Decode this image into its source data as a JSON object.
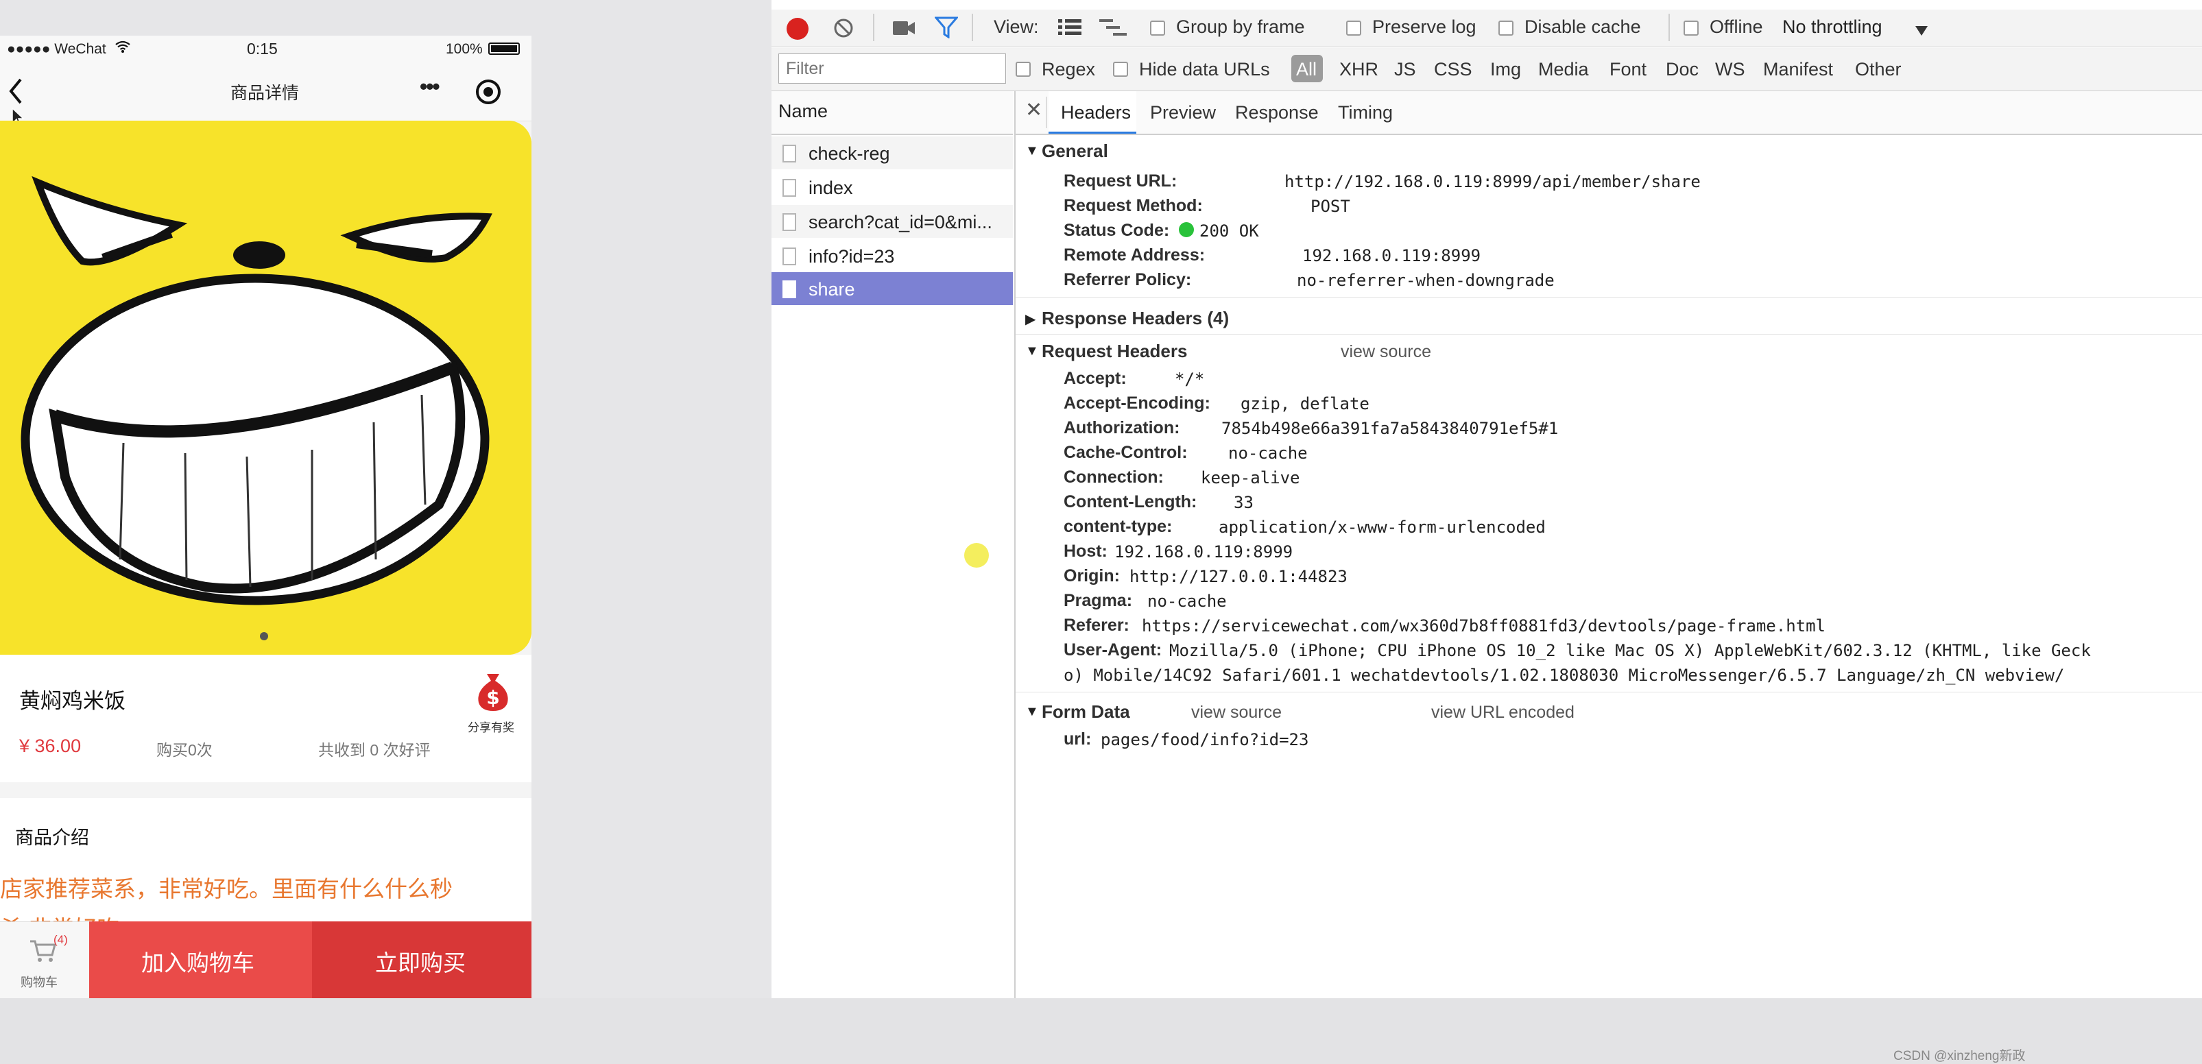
{
  "phone": {
    "status": {
      "carrier": "●●●●● WeChat",
      "wifi_icon": "wifi-icon",
      "time": "0:15",
      "battery": "100%",
      "battery_icon": "battery-icon"
    },
    "nav": {
      "title": "商品详情",
      "more": "•••"
    },
    "product": {
      "name": "黄焖鸡米饭",
      "price": "¥ 36.00",
      "bought": "购买0次",
      "reviews": "共收到 0 次好评",
      "share_label": "分享有奖"
    },
    "intro": {
      "heading": "商品介绍",
      "text": "店家推荐菜系，非常好吃。里面有什么什么秒",
      "text2": "杀 非常好吃"
    },
    "bottom": {
      "cart_badge": "(4)",
      "cart_label": "购物车",
      "add_cart": "加入购物车",
      "buy_now": "立即购买"
    },
    "colors": {
      "yellow": "#F7E32A",
      "price": "#E0393E",
      "add_cart_bg": "#EA4B49",
      "buy_bg": "#D83737"
    }
  },
  "devtools": {
    "toolbar": {
      "view_label": "View:",
      "group_by_frame": "Group by frame",
      "preserve_log": "Preserve log",
      "disable_cache": "Disable cache",
      "offline": "Offline",
      "throttling": "No throttling"
    },
    "filter": {
      "placeholder": "Filter",
      "regex": "Regex",
      "hide_data_urls": "Hide data URLs",
      "types": [
        "All",
        "XHR",
        "JS",
        "CSS",
        "Img",
        "Media",
        "Font",
        "Doc",
        "WS",
        "Manifest",
        "Other"
      ]
    },
    "name_header": "Name",
    "requests": [
      "check-reg",
      "index",
      "search?cat_id=0&mi...",
      "info?id=23",
      "share"
    ],
    "tabs": [
      "Headers",
      "Preview",
      "Response",
      "Timing"
    ],
    "general": {
      "title": "General",
      "request_url_label": "Request URL:",
      "request_url": "http://192.168.0.119:8999/api/member/share",
      "request_method_label": "Request Method:",
      "request_method": "POST",
      "status_code_label": "Status Code:",
      "status_code": "200 OK",
      "remote_address_label": "Remote Address:",
      "remote_address": "192.168.0.119:8999",
      "referrer_policy_label": "Referrer Policy:",
      "referrer_policy": "no-referrer-when-downgrade"
    },
    "response_headers_title": "Response Headers (4)",
    "request_headers": {
      "title": "Request Headers",
      "view_source": "view source",
      "rows": [
        {
          "k": "Accept:",
          "v": "*/*"
        },
        {
          "k": "Accept-Encoding:",
          "v": "gzip, deflate"
        },
        {
          "k": "Authorization:",
          "v": "7854b498e66a391fa7a5843840791ef5#1"
        },
        {
          "k": "Cache-Control:",
          "v": "no-cache"
        },
        {
          "k": "Connection:",
          "v": "keep-alive"
        },
        {
          "k": "Content-Length:",
          "v": "33"
        },
        {
          "k": "content-type:",
          "v": "application/x-www-form-urlencoded"
        },
        {
          "k": "Host:",
          "v": "192.168.0.119:8999"
        },
        {
          "k": "Origin:",
          "v": "http://127.0.0.1:44823"
        },
        {
          "k": "Pragma:",
          "v": "no-cache"
        },
        {
          "k": "Referer:",
          "v": "https://servicewechat.com/wx360d7b8ff0881fd3/devtools/page-frame.html"
        },
        {
          "k": "User-Agent:",
          "v": "Mozilla/5.0 (iPhone; CPU iPhone OS 10_2 like Mac OS X) AppleWebKit/602.3.12 (KHTML, like Geck"
        }
      ],
      "ua_cont": "o) Mobile/14C92 Safari/601.1 wechatdevtools/1.02.1808030 MicroMessenger/6.5.7 Language/zh_CN webview/"
    },
    "form_data": {
      "title": "Form Data",
      "view_source": "view source",
      "view_url_encoded": "view URL encoded",
      "url_label": "url:",
      "url_value": "pages/food/info?id=23"
    },
    "colors": {
      "record": "#D9221F",
      "filter_active": "#2A7BE0",
      "selected_row": "#7C81D3",
      "status_ok": "#29C23A"
    }
  },
  "watermark": "CSDN @xinzheng新政"
}
